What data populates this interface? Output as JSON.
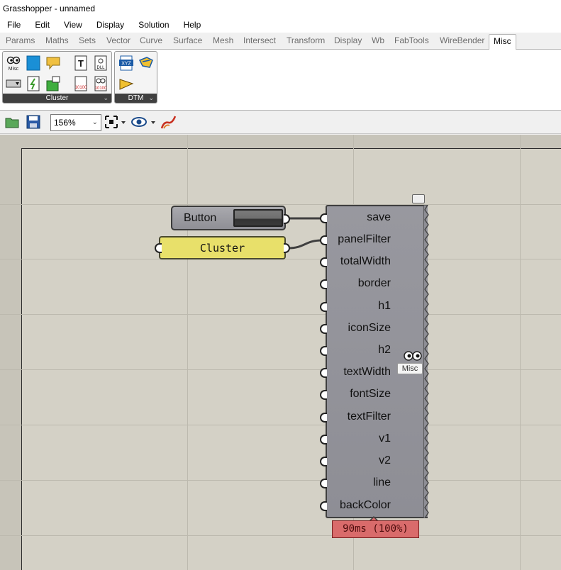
{
  "window": {
    "title": "Grasshopper - unnamed"
  },
  "menu": [
    "File",
    "Edit",
    "View",
    "Display",
    "Solution",
    "Help"
  ],
  "tabs": [
    "Params",
    "Maths",
    "Sets",
    "Vector",
    "Curve",
    "Surface",
    "Mesh",
    "Intersect",
    "Transform",
    "Display",
    "Wb",
    "FabTools",
    "WireBender",
    "Misc"
  ],
  "active_tab": "Misc",
  "ribbon": {
    "groups": [
      {
        "label": "Cluster",
        "arrow": "⌄"
      },
      {
        "label": "DTM",
        "arrow": "⌄"
      }
    ],
    "icon_texts": {
      "misc": "Misc",
      "text": "T",
      "dll": "DLL",
      "xyz": "XYZ",
      "bin1": "10100",
      "bin2": "10100"
    }
  },
  "toolbar": {
    "zoom": "156%",
    "icons": [
      "open-folder-icon",
      "save-icon",
      "zoom-extents-icon",
      "preview-eye-icon",
      "sketch-icon"
    ]
  },
  "canvas": {
    "button_component": {
      "label": "Button"
    },
    "panel": {
      "text": "Cluster"
    },
    "component": {
      "inputs": [
        "save",
        "panelFilter",
        "totalWidth",
        "border",
        "h1",
        "iconSize",
        "h2",
        "textWidth",
        "fontSize",
        "textFilter",
        "v1",
        "v2",
        "line",
        "backColor"
      ],
      "badge": "Misc",
      "timing": "90ms (100%)"
    }
  },
  "colors": {
    "canvas": "#d4d1c6",
    "component": "#8e8e95",
    "panel": "#e8e06a",
    "timer": "#d96b6b"
  }
}
